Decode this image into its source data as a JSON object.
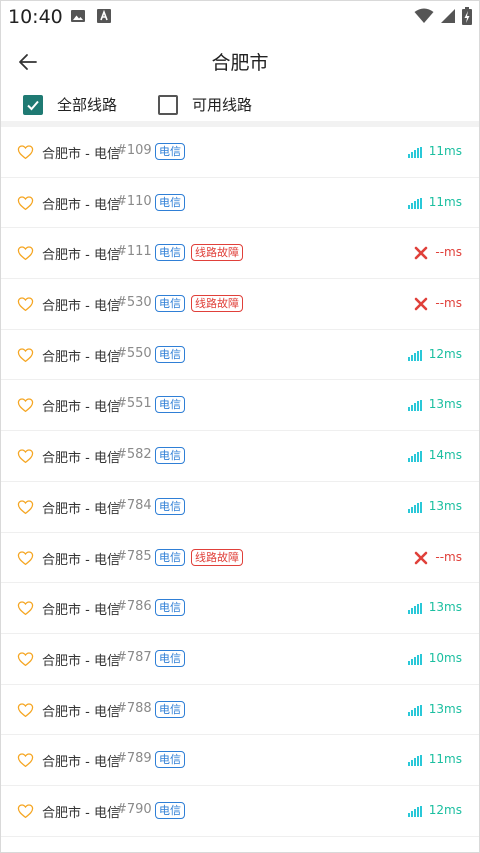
{
  "status_bar": {
    "time": "10:40"
  },
  "header": {
    "title": "合肥市"
  },
  "filters": {
    "all": {
      "label": "全部线路",
      "checked": true
    },
    "available": {
      "label": "可用线路",
      "checked": false
    }
  },
  "routes": [
    {
      "name": "合肥市 - 电信",
      "id": "#109",
      "isp": "电信",
      "fault": "",
      "latency": "11ms",
      "ok": true
    },
    {
      "name": "合肥市 - 电信",
      "id": "#110",
      "isp": "电信",
      "fault": "",
      "latency": "11ms",
      "ok": true
    },
    {
      "name": "合肥市 - 电信",
      "id": "#111",
      "isp": "电信",
      "fault": "线路故障",
      "latency": "--ms",
      "ok": false
    },
    {
      "name": "合肥市 - 电信",
      "id": "#530",
      "isp": "电信",
      "fault": "线路故障",
      "latency": "--ms",
      "ok": false
    },
    {
      "name": "合肥市 - 电信",
      "id": "#550",
      "isp": "电信",
      "fault": "",
      "latency": "12ms",
      "ok": true
    },
    {
      "name": "合肥市 - 电信",
      "id": "#551",
      "isp": "电信",
      "fault": "",
      "latency": "13ms",
      "ok": true
    },
    {
      "name": "合肥市 - 电信",
      "id": "#582",
      "isp": "电信",
      "fault": "",
      "latency": "14ms",
      "ok": true
    },
    {
      "name": "合肥市 - 电信",
      "id": "#784",
      "isp": "电信",
      "fault": "",
      "latency": "13ms",
      "ok": true
    },
    {
      "name": "合肥市 - 电信",
      "id": "#785",
      "isp": "电信",
      "fault": "线路故障",
      "latency": "--ms",
      "ok": false
    },
    {
      "name": "合肥市 - 电信",
      "id": "#786",
      "isp": "电信",
      "fault": "",
      "latency": "13ms",
      "ok": true
    },
    {
      "name": "合肥市 - 电信",
      "id": "#787",
      "isp": "电信",
      "fault": "",
      "latency": "10ms",
      "ok": true
    },
    {
      "name": "合肥市 - 电信",
      "id": "#788",
      "isp": "电信",
      "fault": "",
      "latency": "13ms",
      "ok": true
    },
    {
      "name": "合肥市 - 电信",
      "id": "#789",
      "isp": "电信",
      "fault": "",
      "latency": "11ms",
      "ok": true
    },
    {
      "name": "合肥市 - 电信",
      "id": "#790",
      "isp": "电信",
      "fault": "",
      "latency": "12ms",
      "ok": true
    }
  ],
  "colors": {
    "accent": "#1f7a73",
    "isp": "#2f7fd6",
    "fault": "#e0403a",
    "latency_ok": "#1bbfa0",
    "heart": "#f5a623",
    "signal": "#2ac8d8"
  },
  "icons": {
    "back": "arrow-left-icon",
    "favorite": "heart-outline-icon",
    "signal": "signal-bars-icon",
    "fail": "cross-icon"
  }
}
